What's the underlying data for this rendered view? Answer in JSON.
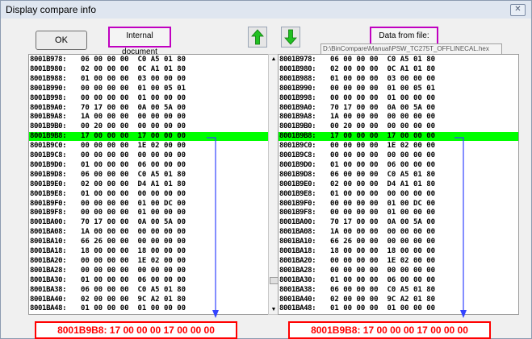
{
  "window": {
    "title": "Display compare info",
    "close_symbol": "✕"
  },
  "toolbar": {
    "ok_label": "OK",
    "left_label": "Internal document",
    "right_label": "Data from file:",
    "file_path": "D:\\BinCompare\\Manual\\PSW_TC275T_OFFLINECAL.hex",
    "up_icon": "green-up-arrow",
    "down_icon": "green-down-arrow"
  },
  "highlight_color": "#00ff00",
  "callout_color": "#ff0000",
  "rows": [
    {
      "addr": "8001B978:",
      "bytes": "06 00 00 00  C0 A5 01 80"
    },
    {
      "addr": "8001B980:",
      "bytes": "02 00 00 00  0C A1 01 80"
    },
    {
      "addr": "8001B988:",
      "bytes": "01 00 00 00  03 00 00 00"
    },
    {
      "addr": "8001B990:",
      "bytes": "00 00 00 00  01 00 05 01"
    },
    {
      "addr": "8001B998:",
      "bytes": "00 00 00 00  01 00 00 00"
    },
    {
      "addr": "8001B9A0:",
      "bytes": "70 17 00 00  0A 00 5A 00"
    },
    {
      "addr": "8001B9A8:",
      "bytes": "1A 00 00 00  00 00 00 00"
    },
    {
      "addr": "8001B9B0:",
      "bytes": "00 20 00 00  00 00 00 00"
    },
    {
      "addr": "8001B9B8:",
      "bytes": "17 00 00 00  17 00 00 00",
      "highlight": true
    },
    {
      "addr": "8001B9C0:",
      "bytes": "00 00 00 00  1E 02 00 00"
    },
    {
      "addr": "8001B9C8:",
      "bytes": "00 00 00 00  00 00 00 00"
    },
    {
      "addr": "8001B9D0:",
      "bytes": "01 00 00 00  06 00 00 00"
    },
    {
      "addr": "8001B9D8:",
      "bytes": "06 00 00 00  C0 A5 01 80"
    },
    {
      "addr": "8001B9E0:",
      "bytes": "02 00 00 00  D4 A1 01 80"
    },
    {
      "addr": "8001B9E8:",
      "bytes": "01 00 00 00  00 00 00 00"
    },
    {
      "addr": "8001B9F0:",
      "bytes": "00 00 00 00  01 00 DC 00"
    },
    {
      "addr": "8001B9F8:",
      "bytes": "00 00 00 00  01 00 00 00"
    },
    {
      "addr": "8001BA00:",
      "bytes": "70 17 00 00  0A 00 5A 00"
    },
    {
      "addr": "8001BA08:",
      "bytes": "1A 00 00 00  00 00 00 00"
    },
    {
      "addr": "8001BA10:",
      "bytes": "66 26 00 00  00 00 00 00"
    },
    {
      "addr": "8001BA18:",
      "bytes": "18 00 00 00  18 00 00 00"
    },
    {
      "addr": "8001BA20:",
      "bytes": "00 00 00 00  1E 02 00 00"
    },
    {
      "addr": "8001BA28:",
      "bytes": "00 00 00 00  00 00 00 00"
    },
    {
      "addr": "8001BA30:",
      "bytes": "01 00 00 00  06 00 00 00"
    },
    {
      "addr": "8001BA38:",
      "bytes": "06 00 00 00  C0 A5 01 80"
    },
    {
      "addr": "8001BA40:",
      "bytes": "02 00 00 00  9C A2 01 80"
    },
    {
      "addr": "8001BA48:",
      "bytes": "01 00 00 00  01 00 00 00"
    }
  ],
  "callouts": {
    "left": "8001B9B8: 17 00 00 00 17 00 00 00",
    "right": "8001B9B8: 17 00 00 00 17 00 00 00"
  }
}
